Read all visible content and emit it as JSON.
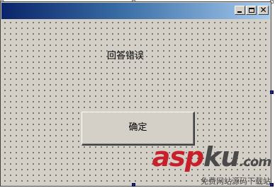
{
  "form": {
    "title": "",
    "caption_buttons": [
      {
        "name": "minimize",
        "glyph": ""
      },
      {
        "name": "maximize",
        "glyph": ""
      },
      {
        "name": "close",
        "glyph": "✕"
      }
    ]
  },
  "label": {
    "text": "回答错误"
  },
  "button": {
    "text": "确定"
  },
  "watermark": {
    "asp": "asp",
    "ku": "ku",
    "com": ".com",
    "tagline": "免费网站源码下载站"
  },
  "colors": {
    "titlebar_start": "#0a246a",
    "titlebar_end": "#a6caf0",
    "form_background": "#d4d0c8",
    "selection_handle": "#1a2a8a",
    "watermark_red": "#c8202a"
  }
}
